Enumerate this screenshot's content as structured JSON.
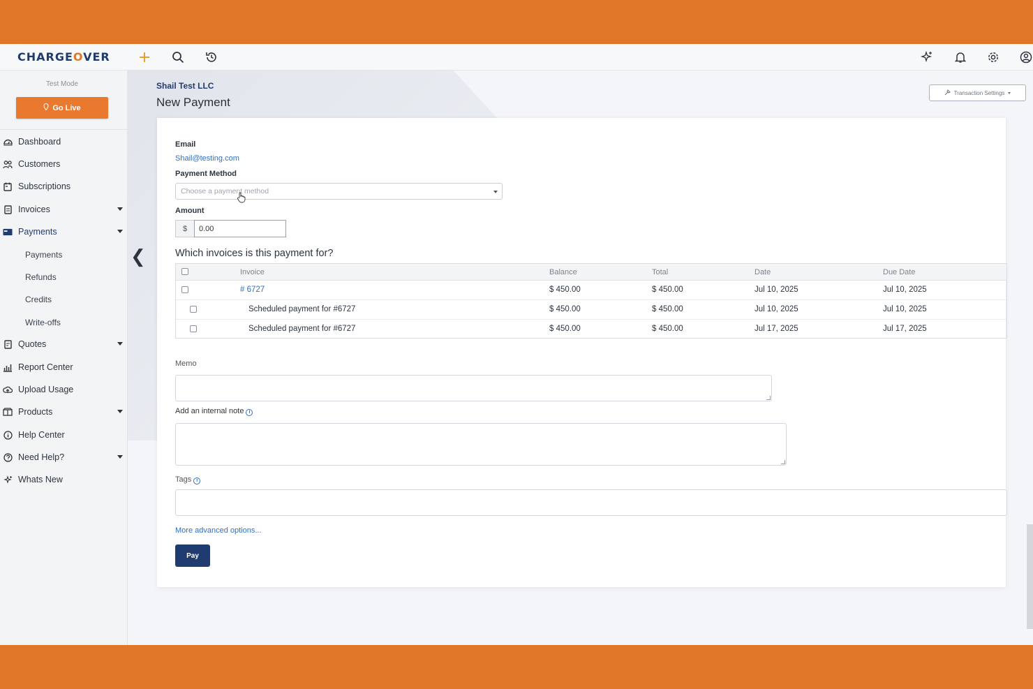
{
  "app": {
    "logo_main": "CHARGE",
    "logo_o": "O",
    "logo_tail": "VER"
  },
  "topbar": {
    "icons": [
      "plus-icon",
      "search-icon",
      "history-icon",
      "sparkle-icon",
      "bell-icon",
      "gear-icon",
      "user-icon"
    ]
  },
  "sidebar": {
    "mode_label": "Test Mode",
    "go_live_label": "Go Live",
    "items": [
      {
        "label": "Dashboard",
        "icon": "dashboard-icon"
      },
      {
        "label": "Customers",
        "icon": "customers-icon"
      },
      {
        "label": "Subscriptions",
        "icon": "subscriptions-icon"
      },
      {
        "label": "Invoices",
        "icon": "invoice-icon"
      },
      {
        "label": "Payments",
        "icon": "card-icon"
      },
      {
        "label": "Quotes",
        "icon": "quote-icon"
      },
      {
        "label": "Report Center",
        "icon": "report-icon"
      },
      {
        "label": "Upload Usage",
        "icon": "upload-icon"
      },
      {
        "label": "Products",
        "icon": "products-icon"
      },
      {
        "label": "Help Center",
        "icon": "info-icon"
      },
      {
        "label": "Need Help?",
        "icon": "help-icon"
      },
      {
        "label": "Whats New",
        "icon": "sparkle-icon"
      }
    ],
    "payments_sub": [
      "Payments",
      "Refunds",
      "Credits",
      "Write-offs"
    ]
  },
  "header": {
    "company": "Shail Test LLC",
    "title": "New Payment",
    "settings_label": "Transaction Settings"
  },
  "form": {
    "email_label": "Email",
    "email_value": "Shail@testing.com",
    "method_label": "Payment Method",
    "method_placeholder": "Choose a payment method",
    "amount_label": "Amount",
    "currency": "$",
    "amount_value": "0.00",
    "invoices_title": "Which invoices is this payment for?",
    "memo_label": "Memo",
    "note_label": "Add an internal note",
    "tags_label": "Tags",
    "advanced_link": "More advanced options...",
    "pay_label": "Pay"
  },
  "table": {
    "headers": [
      "Invoice",
      "Balance",
      "Total",
      "Date",
      "Due Date"
    ],
    "rows": [
      {
        "invoice": "# 6727",
        "balance": "$ 450.00",
        "total": "$ 450.00",
        "date": "Jul 10, 2025",
        "due": "Jul 10, 2025"
      },
      {
        "invoice": "Scheduled payment for #6727",
        "balance": "$ 450.00",
        "total": "$ 450.00",
        "date": "Jul 10, 2025",
        "due": "Jul 10, 2025"
      },
      {
        "invoice": "Scheduled payment for #6727",
        "balance": "$ 450.00",
        "total": "$ 450.00",
        "date": "Jul 17, 2025",
        "due": "Jul 17, 2025"
      }
    ]
  },
  "colors": {
    "brand_orange": "#E07726",
    "brand_navy": "#1f3b70",
    "link_blue": "#2f6fc4"
  }
}
